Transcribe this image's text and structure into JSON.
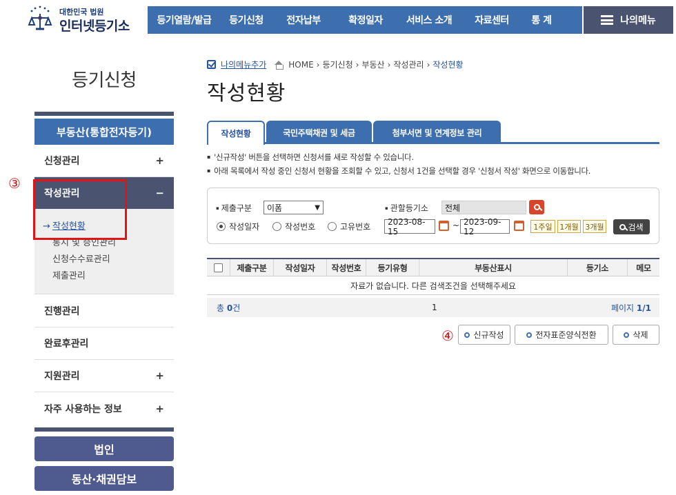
{
  "header": {
    "logo_small": "대한민국 법원",
    "logo_big": "인터넷등기소",
    "nav": [
      "등기열람/발급",
      "등기신청",
      "전자납부",
      "확정일자",
      "서비스 소개",
      "자료센터",
      "통 계"
    ],
    "mymenu_label": "나의메뉴"
  },
  "sidebar": {
    "title": "등기신청",
    "section_header": "부동산(통합전자등기)",
    "items": [
      {
        "label": "신청관리",
        "mark": "+"
      },
      {
        "label": "작성관리",
        "mark": "−"
      },
      {
        "label": "진행관리",
        "mark": ""
      },
      {
        "label": "완료후관리",
        "mark": ""
      },
      {
        "label": "지원관리",
        "mark": "+"
      },
      {
        "label": "자주 사용하는 정보",
        "mark": "+"
      }
    ],
    "sub_items": [
      "작성현황",
      "통지 및 증인관리",
      "신청수수료관리",
      "제출관리"
    ],
    "bottom_buttons": [
      "법인",
      "동산·채권담보"
    ]
  },
  "annotations": {
    "step3": "③",
    "step4": "④"
  },
  "breadcrumb": {
    "add_mymenu": "나의메뉴추가",
    "items": [
      "HOME",
      "등기신청",
      "부동산",
      "작성관리"
    ],
    "current": "작성현황"
  },
  "page_title": "작성현황",
  "tabs": [
    "작성현황",
    "국민주택채권 및 세금",
    "첨부서면 및 연계정보 관리"
  ],
  "notes": [
    "'신규작성' 버튼을 선택하면 신청서를 새로 작성할 수 있습니다.",
    "아래 목록에서 작성 중인 신청서 현황을 조회할 수 있고, 신청서 1건을 선택할 경우 '신청서 작성' 화면으로 이동합니다."
  ],
  "search": {
    "submit_type_label": "제출구분",
    "submit_type_value": "이폼",
    "court_label": "관할등기소",
    "court_value": "전체",
    "radios": [
      "작성일자",
      "작성번호",
      "고유번호"
    ],
    "selected_radio": "작성일자",
    "date_from": "2023-08-15",
    "date_sep": "~",
    "date_to": "2023-09-12",
    "quick": [
      "1주일",
      "1개월",
      "3개월"
    ],
    "search_button": "검색"
  },
  "table": {
    "columns": [
      "제출구분",
      "작성일자",
      "작성번호",
      "등기유형",
      "부동산표시",
      "등기소",
      "메모"
    ],
    "empty_message": "자료가 없습니다. 다른 검색조건을 선택해주세요"
  },
  "pager": {
    "total_prefix": "총 ",
    "total_count": "0",
    "total_suffix": "건",
    "current_page": "1",
    "page_label": "페이지 ",
    "page_of": "1/1"
  },
  "actions": [
    "신규작성",
    "전자표준양식전환",
    "삭제"
  ],
  "colors": {
    "primary": "#3d6fae",
    "dark": "#4a5470",
    "annotation": "#e01414"
  }
}
